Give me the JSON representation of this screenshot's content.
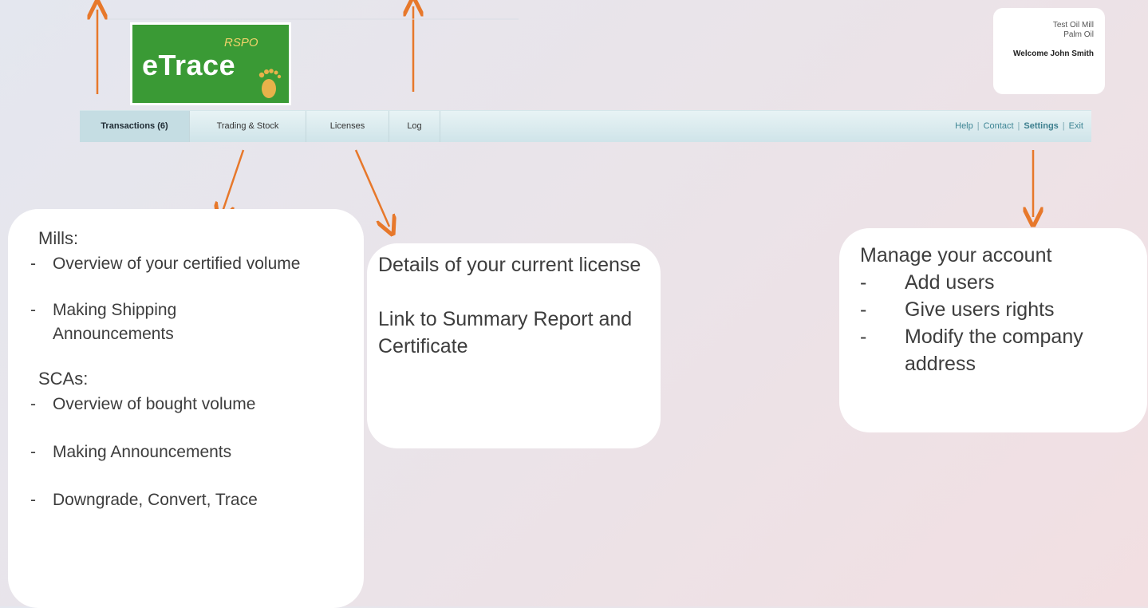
{
  "logo": {
    "brand": "RSPO",
    "name": "eTrace"
  },
  "user": {
    "company": "Test Oil Mill",
    "product": "Palm Oil",
    "welcome": "Welcome John Smith"
  },
  "nav": {
    "tabs": [
      {
        "label": "Transactions (6)",
        "active": true
      },
      {
        "label": "Trading & Stock"
      },
      {
        "label": "Licenses"
      },
      {
        "label": "Log"
      }
    ],
    "links": {
      "help": "Help",
      "contact": "Contact",
      "settings": "Settings",
      "exit": "Exit",
      "separator": "|"
    }
  },
  "callouts": {
    "trading": {
      "mills_heading": "Mills:",
      "mills_items": [
        "Overview of your certified volume",
        "Making Shipping Announcements"
      ],
      "scas_heading": "SCAs:",
      "scas_items": [
        "Overview of bought volume",
        "Making Announcements",
        "Downgrade, Convert, Trace"
      ],
      "dash": "-"
    },
    "licenses": {
      "line1": "Details of your current license",
      "line2": "Link to Summary Report and Certificate"
    },
    "settings": {
      "heading": "Manage your account",
      "items": [
        "Add users",
        "Give users rights",
        "Modify the company address"
      ],
      "dash": "-"
    }
  },
  "colors": {
    "arrow": "#e7782b",
    "logo_green": "#3a9a35",
    "nav_bg": "#d4e8ec",
    "link": "#3d8594"
  }
}
